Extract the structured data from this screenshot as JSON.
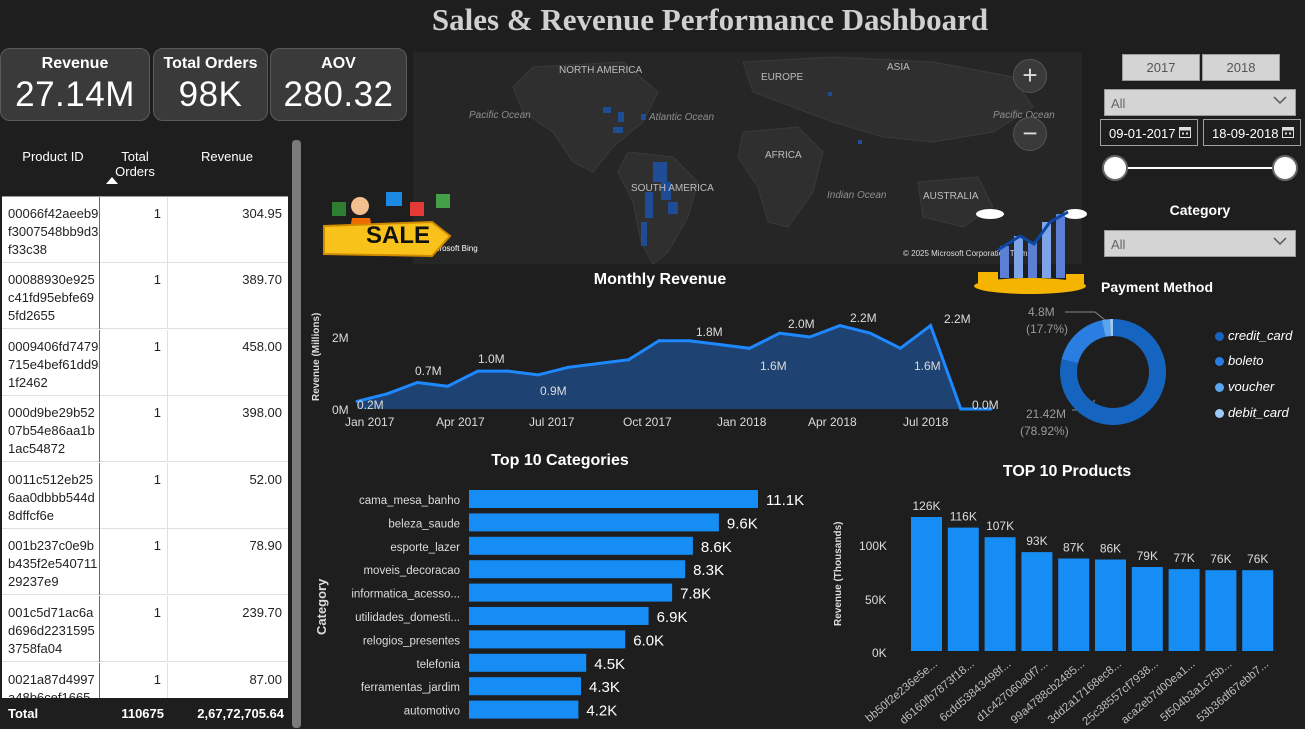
{
  "title": "Sales & Revenue Performance Dashboard",
  "kpis": {
    "revenue": {
      "label": "Revenue",
      "value": "27.14M"
    },
    "orders": {
      "label": "Total Orders",
      "value": "98K"
    },
    "aov": {
      "label": "AOV",
      "value": "280.32"
    }
  },
  "product_table": {
    "headers": {
      "product_id": "Product ID",
      "total_orders": "Total Orders",
      "revenue": "Revenue"
    },
    "rows": [
      {
        "id": "00066f42aeeb9f3007548bb9d3f33c38",
        "orders": "1",
        "revenue": "304.95"
      },
      {
        "id": "00088930e925c41fd95ebfe695fd2655",
        "orders": "1",
        "revenue": "389.70"
      },
      {
        "id": "0009406fd7479715e4bef61dd91f2462",
        "orders": "1",
        "revenue": "458.00"
      },
      {
        "id": "000d9be29b5207b54e86aa1b1ac54872",
        "orders": "1",
        "revenue": "398.00"
      },
      {
        "id": "0011c512eb256aa0dbbb544d8dffcf6e",
        "orders": "1",
        "revenue": "52.00"
      },
      {
        "id": "001b237c0e9bb435f2e54071129237e9",
        "orders": "1",
        "revenue": "78.90"
      },
      {
        "id": "001c5d71ac6ad696d22315953758fa04",
        "orders": "1",
        "revenue": "239.70"
      },
      {
        "id": "0021a87d4997a48b6cef1665",
        "orders": "1",
        "revenue": "87.00"
      }
    ],
    "total": {
      "label": "Total",
      "orders": "110675",
      "revenue": "2,67,72,705.64"
    }
  },
  "map": {
    "labels": [
      "NORTH AMERICA",
      "EUROPE",
      "ASIA",
      "Pacific Ocean",
      "Atlantic Ocean",
      "AFRICA",
      "SOUTH AMERICA",
      "Indian Ocean",
      "AUSTRALIA",
      "Pacific Ocean"
    ],
    "attribution": "© 2025 Microsoft Corporation Terms",
    "bing": "Microsoft Bing",
    "zoom_in": "+",
    "zoom_out": "−"
  },
  "sale_sticker": "SALE",
  "filters": {
    "years": [
      "2017",
      "2018"
    ],
    "all_dropdown": "All",
    "start_date": "09-01-2017",
    "end_date": "18-09-2018",
    "category_title": "Category",
    "category_value": "All"
  },
  "monthly_revenue": {
    "title": "Monthly Revenue",
    "ylabel": "Revenue (Millions)",
    "y_ticks": [
      "0M",
      "2M"
    ],
    "x_ticks": [
      "Jan 2017",
      "Apr 2017",
      "Jul 2017",
      "Oct 2017",
      "Jan 2018",
      "Apr 2018",
      "Jul 2018"
    ],
    "data_labels": [
      "0.2M",
      "0.7M",
      "1.0M",
      "0.9M",
      "1.8M",
      "1.6M",
      "2.0M",
      "2.2M",
      "1.6M",
      "2.2M",
      "0.0M"
    ]
  },
  "payment": {
    "title": "Payment Method",
    "labels": {
      "small": "4.8M",
      "small_pct": "(17.7%)",
      "large": "21.42M",
      "large_pct": "(78.92%)"
    },
    "legend": [
      "credit_card",
      "boleto",
      "voucher",
      "debit_card"
    ],
    "colors": [
      "#1565c0",
      "#2a7de1",
      "#5ba5ee",
      "#9cc9f5"
    ]
  },
  "chart_data": [
    {
      "type": "area",
      "title": "Monthly Revenue",
      "ylabel": "Revenue (Millions)",
      "x": [
        "2016-12",
        "2017-01",
        "2017-02",
        "2017-03",
        "2017-04",
        "2017-05",
        "2017-06",
        "2017-07",
        "2017-08",
        "2017-09",
        "2017-10",
        "2017-11",
        "2017-12",
        "2018-01",
        "2018-02",
        "2018-03",
        "2018-04",
        "2018-05",
        "2018-06",
        "2018-07",
        "2018-08",
        "2018-09"
      ],
      "values": [
        0.2,
        0.4,
        0.7,
        0.6,
        1.0,
        1.0,
        0.9,
        1.1,
        1.2,
        1.3,
        1.8,
        1.8,
        1.7,
        1.6,
        2.0,
        1.9,
        2.2,
        2.0,
        1.6,
        2.2,
        0.0,
        0.0
      ],
      "ylim": [
        0,
        2.4
      ]
    },
    {
      "type": "bar",
      "title": "Top 10 Categories",
      "ylabel": "Category",
      "categories": [
        "cama_mesa_banho",
        "beleza_saude",
        "esporte_lazer",
        "moveis_decoracao",
        "informatica_acesso...",
        "utilidades_domesti...",
        "relogios_presentes",
        "telefonia",
        "ferramentas_jardim",
        "automotivo"
      ],
      "values": [
        11.1,
        9.6,
        8.6,
        8.3,
        7.8,
        6.9,
        6.0,
        4.5,
        4.3,
        4.2
      ],
      "value_labels": [
        "11.1K",
        "9.6K",
        "8.6K",
        "8.3K",
        "7.8K",
        "6.9K",
        "6.0K",
        "4.5K",
        "4.3K",
        "4.2K"
      ]
    },
    {
      "type": "bar",
      "title": "TOP 10 Products",
      "ylabel": "Revenue (Thousands)",
      "y_ticks": [
        "0K",
        "50K",
        "100K"
      ],
      "categories": [
        "bb50f2e236e5e...",
        "d6160fb7873f18...",
        "6cdd53843498f...",
        "d1c427060a0f7...",
        "99a4788cb2485...",
        "3dd2a17168ec8...",
        "25c38557cf7938...",
        "aca2eb7d00ea1...",
        "5f504b3a1c75b...",
        "53b36df67ebb7..."
      ],
      "values": [
        126,
        116,
        107,
        93,
        87,
        86,
        79,
        77,
        76,
        76
      ],
      "value_labels": [
        "126K",
        "116K",
        "107K",
        "93K",
        "87K",
        "86K",
        "79K",
        "77K",
        "76K",
        "76K"
      ],
      "ylim": [
        0,
        130
      ]
    },
    {
      "type": "pie",
      "title": "Payment Method",
      "categories": [
        "credit_card",
        "boleto",
        "voucher",
        "debit_card"
      ],
      "values": [
        78.92,
        17.7,
        2.4,
        0.98
      ]
    }
  ]
}
